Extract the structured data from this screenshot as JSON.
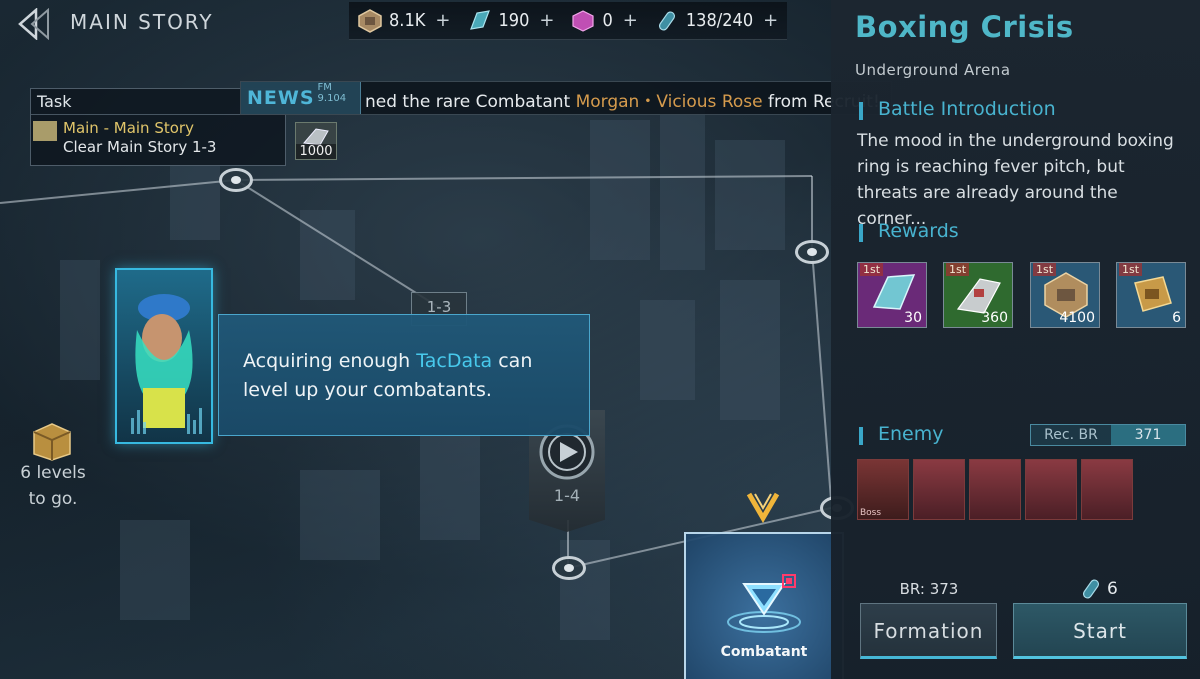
{
  "header": {
    "back_icon": "back-arrow-icon",
    "title": "MAIN STORY"
  },
  "resources": [
    {
      "icon": "credits-crate-icon",
      "value": "8.1K",
      "plus": "+"
    },
    {
      "icon": "crystal-icon",
      "value": "190",
      "plus": "+"
    },
    {
      "icon": "pink-cube-icon",
      "value": "0",
      "plus": "+"
    },
    {
      "icon": "stamina-capsule-icon",
      "value": "138/240",
      "plus": "+"
    }
  ],
  "task": {
    "header": "Task",
    "title": "Main - Main Story",
    "description": "Clear Main Story 1-3",
    "reward_amount": "1000"
  },
  "news": {
    "label": "NEWS",
    "frequency": "FM 9.104",
    "text_before": "ned the rare Combatant ",
    "highlight": "Morgan・Vicious Rose",
    "text_after": " from Recruit!"
  },
  "map": {
    "stage_13": "1-3",
    "stage_14": "1-4"
  },
  "tutorial": {
    "text_before": "Acquiring enough ",
    "highlight": "TacData",
    "text_after": " can level up your combatants."
  },
  "chest": {
    "label": "6 levels to go."
  },
  "combatant": {
    "label": "Combatant"
  },
  "stage": {
    "title": "Boxing Crisis",
    "location": "Underground Arena",
    "intro_heading": "Battle Introduction",
    "intro_text": "The mood in the underground boxing ring is reaching fever pitch, but threats are already around the corner...",
    "rewards_heading": "Rewards",
    "rewards": [
      {
        "tag": "1st",
        "count": "30",
        "icon": "crystal-shard-icon",
        "color": "#6a2a78"
      },
      {
        "tag": "1st",
        "count": "360",
        "icon": "weapon-part-icon",
        "color": "#2f6a2f"
      },
      {
        "tag": "1st",
        "count": "4100",
        "icon": "credits-crate-icon",
        "color": "#2a5876"
      },
      {
        "tag": "1st",
        "count": "6",
        "icon": "exp-chip-icon",
        "color": "#2a5876"
      }
    ],
    "enemy_heading": "Enemy",
    "rec_br_label": "Rec. BR",
    "rec_br_value": "371",
    "enemies": [
      {
        "label": "Boss"
      },
      {
        "label": ""
      },
      {
        "label": ""
      },
      {
        "label": ""
      },
      {
        "label": ""
      }
    ],
    "br_label": "BR: 373",
    "formation_label": "Formation",
    "start_cost": "6",
    "start_label": "Start"
  },
  "colors": {
    "accent": "#4fb7c8",
    "news_highlight": "#d59b4d",
    "tutorial_highlight": "#48c9ec",
    "task_title": "#e0c56a"
  }
}
